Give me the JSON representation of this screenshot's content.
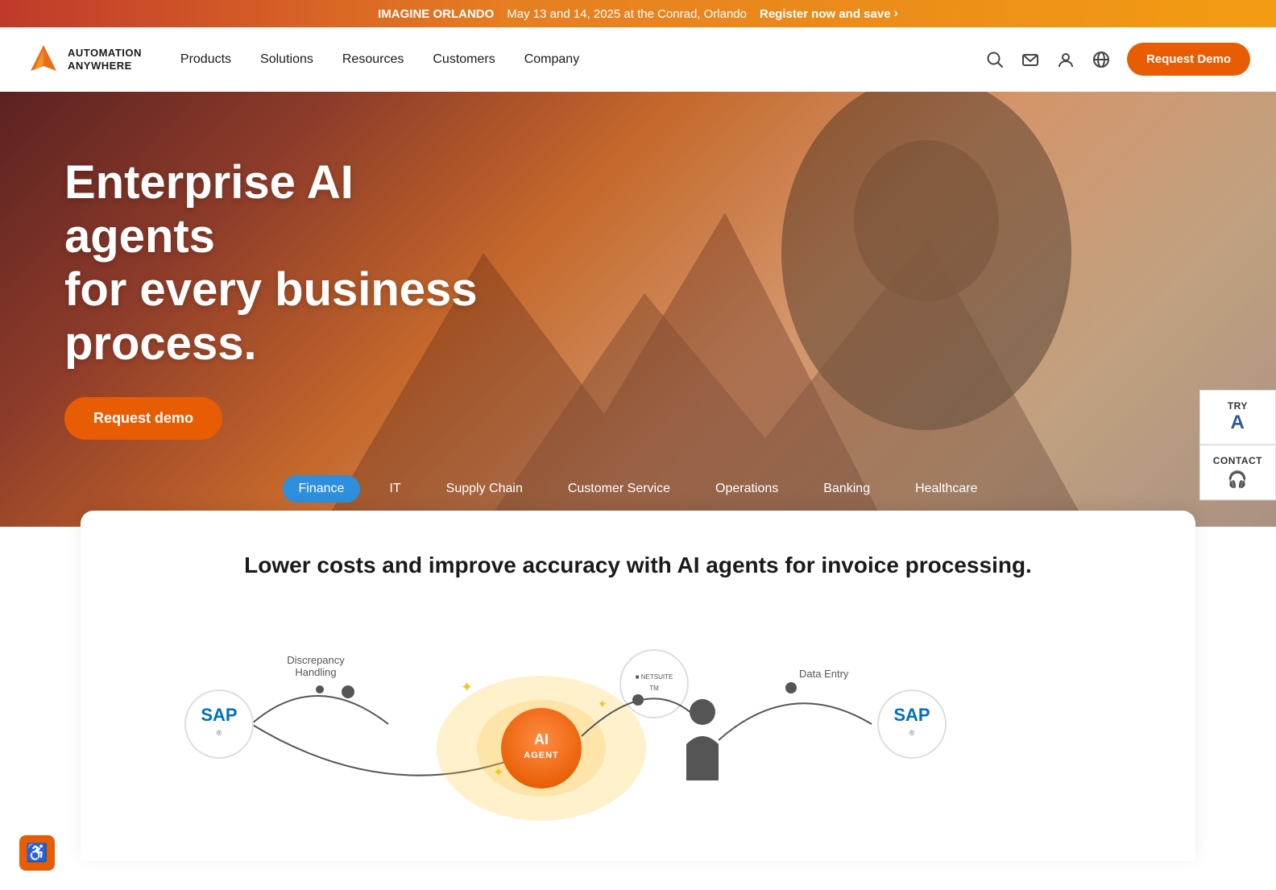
{
  "banner": {
    "event_name": "IMAGINE ORLANDO",
    "event_date": "May 13 and 14, 2025 at the Conrad, Orlando",
    "register_text": "Register now and save",
    "register_arrow": "›"
  },
  "header": {
    "logo_line1": "AUTOMATION",
    "logo_line2": "ANYWHERE",
    "nav_items": [
      {
        "label": "Products",
        "id": "products"
      },
      {
        "label": "Solutions",
        "id": "solutions"
      },
      {
        "label": "Resources",
        "id": "resources"
      },
      {
        "label": "Customers",
        "id": "customers"
      },
      {
        "label": "Company",
        "id": "company"
      }
    ],
    "request_demo_label": "Request Demo"
  },
  "hero": {
    "title_line1": "Enterprise AI agents",
    "title_line2": "for every business process.",
    "cta_label": "Request demo"
  },
  "industry_tabs": [
    {
      "label": "Finance",
      "active": true
    },
    {
      "label": "IT",
      "active": false
    },
    {
      "label": "Supply Chain",
      "active": false
    },
    {
      "label": "Customer Service",
      "active": false
    },
    {
      "label": "Operations",
      "active": false
    },
    {
      "label": "Banking",
      "active": false
    },
    {
      "label": "Healthcare",
      "active": false
    }
  ],
  "side_widget": {
    "try_label": "TRY",
    "try_letter": "A",
    "contact_label": "CONTACT",
    "contact_icon": "🎧"
  },
  "content_card": {
    "title": "Lower costs and improve accuracy with AI agents for invoice processing.",
    "diagram": {
      "left_logo": "SAP",
      "middle_logo": "NETSUITE",
      "discrepancy_label": "Discrepancy\nHandling",
      "data_entry_label": "Data Entry",
      "right_logo": "SAP",
      "ai_agent_label_1": "AI",
      "ai_agent_label_2": "AGENT"
    }
  },
  "accessibility": {
    "icon": "♿"
  }
}
